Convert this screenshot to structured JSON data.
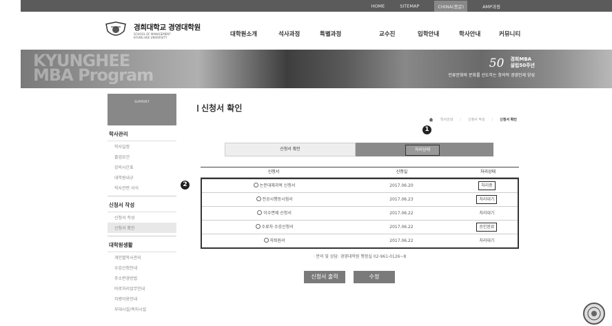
{
  "topbar": {
    "links": [
      "HOME",
      "SITEMAP",
      "CHINA(중문)",
      "AMP과정"
    ]
  },
  "header": {
    "logo_ko": "경희대학교 경영대학원",
    "logo_en1": "SCHOOL OF MANAGEMENT",
    "logo_en2": "KYUNG HEE UNIVERSITY",
    "gnb": [
      "대학원소개",
      "석사과정",
      "특별과정",
      "교수진",
      "입학안내",
      "학사안내",
      "커뮤니티"
    ]
  },
  "banner": {
    "big_text_1": "KYUNGHEE",
    "big_text_2": "MBA Program",
    "fifty": "50",
    "mba_1": "경희MBA",
    "mba_2": "설립50주년",
    "slogan": "인류문화와 문화를 선도하는 창의적 경영인재 양성"
  },
  "lnb": {
    "sub": "SUPPORT",
    "title": "학사안내",
    "groups": [
      {
        "head": "학사관리",
        "items": [
          "학사일정",
          "졸업요건",
          "강의시간표",
          "대학원내규",
          "학사관련 서식"
        ]
      },
      {
        "head": "신청서 작성",
        "items": [
          "신청서 작성",
          "신청서 확인"
        ]
      },
      {
        "head": "대학원생활",
        "items": [
          "개인별학사관리",
          "수강신청안내",
          "주소변경방법",
          "바로처리업무안내",
          "차량이용안내",
          "부대시설/복지시설"
        ]
      }
    ]
  },
  "main": {
    "title": "신청서 확인",
    "breadcrumb": [
      "학사안내",
      "신청서 작성",
      "신청서 확인"
    ],
    "marker1": "1",
    "marker2": "2",
    "step1": "신청서 확인",
    "step2_button": "처리상태",
    "table": {
      "headers": [
        "신청서",
        "신청일",
        "처리상태"
      ],
      "rows": [
        {
          "name": "논문대체과목 신청서",
          "date": "2017.06.20",
          "status": "처리중",
          "boxed": true
        },
        {
          "name": "전공시행등시험서",
          "date": "2017.06.23",
          "status": "처리대기",
          "boxed": true
        },
        {
          "name": "이수면제 신청서",
          "date": "2017.06.22",
          "status": "처리대기",
          "boxed": false
        },
        {
          "name": "수료자 수강신청서",
          "date": "2017.06.22",
          "status": "승인완료",
          "boxed": true
        },
        {
          "name": "자퇴원서",
          "date": "2017.06.22",
          "status": "처리대기",
          "boxed": false
        }
      ]
    },
    "contact": "· 문의 및 상담: 경영대학원 행정실 02-961-0126~8",
    "print_button": "신청서 출력",
    "edit_button": "수정"
  }
}
